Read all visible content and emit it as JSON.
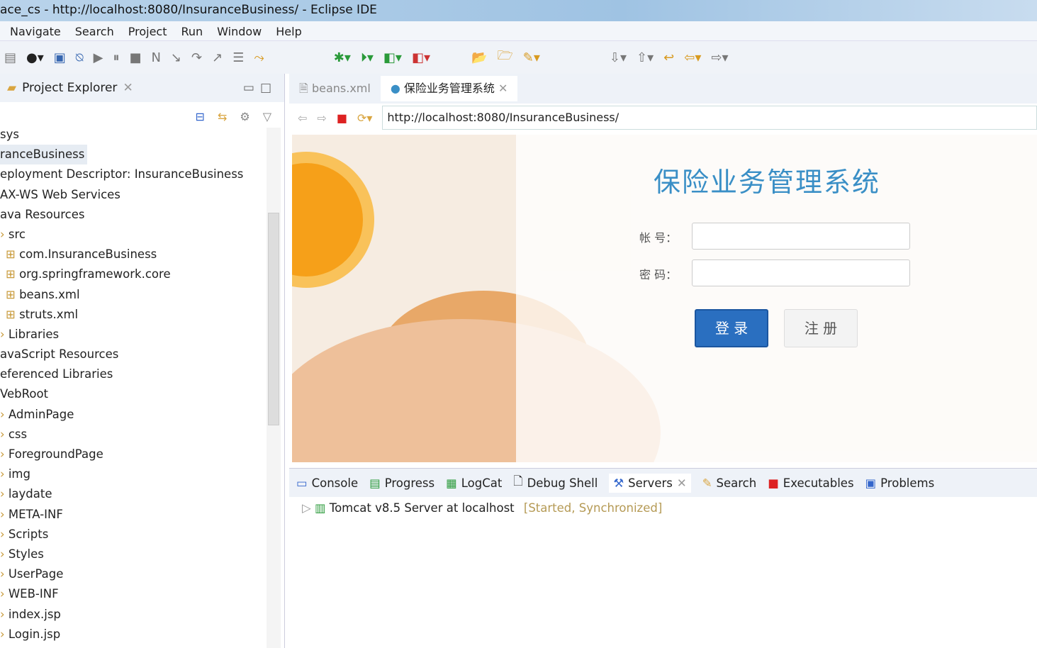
{
  "window": {
    "title": "ace_cs - http://localhost:8080/InsuranceBusiness/ - Eclipse IDE"
  },
  "menu": [
    "Navigate",
    "Search",
    "Project",
    "Run",
    "Window",
    "Help"
  ],
  "left_panel": {
    "tab": "Project Explorer",
    "tree": [
      {
        "label": "sys",
        "indent": 0
      },
      {
        "label": "ranceBusiness",
        "indent": 0,
        "selected": true
      },
      {
        "label": "eployment Descriptor: InsuranceBusiness",
        "indent": 0
      },
      {
        "label": "AX-WS Web Services",
        "indent": 0
      },
      {
        "label": "ava Resources",
        "indent": 0
      },
      {
        "label": "src",
        "indent": 1
      },
      {
        "label": "com.InsuranceBusiness",
        "indent": 2
      },
      {
        "label": "org.springframework.core",
        "indent": 2
      },
      {
        "label": "beans.xml",
        "indent": 2
      },
      {
        "label": "struts.xml",
        "indent": 2
      },
      {
        "label": "Libraries",
        "indent": 1
      },
      {
        "label": "avaScript Resources",
        "indent": 0
      },
      {
        "label": "eferenced Libraries",
        "indent": 0
      },
      {
        "label": "VebRoot",
        "indent": 0
      },
      {
        "label": "AdminPage",
        "indent": 1
      },
      {
        "label": "css",
        "indent": 1
      },
      {
        "label": "ForegroundPage",
        "indent": 1
      },
      {
        "label": "img",
        "indent": 1
      },
      {
        "label": "laydate",
        "indent": 1
      },
      {
        "label": "META-INF",
        "indent": 1
      },
      {
        "label": "Scripts",
        "indent": 1
      },
      {
        "label": "Styles",
        "indent": 1
      },
      {
        "label": "UserPage",
        "indent": 1
      },
      {
        "label": "WEB-INF",
        "indent": 1
      },
      {
        "label": "index.jsp",
        "indent": 1
      },
      {
        "label": "Login.jsp",
        "indent": 1
      }
    ]
  },
  "editor": {
    "tabs": [
      {
        "label": "beans.xml"
      },
      {
        "label": "保险业务管理系统",
        "active": true
      }
    ],
    "url": "http://localhost:8080/InsuranceBusiness/",
    "page": {
      "title": "保险业务管理系统",
      "account_label": "帐  号：",
      "password_label": "密  码：",
      "account_value": "",
      "password_value": "",
      "login": "登 录",
      "register": "注 册"
    }
  },
  "bottom": {
    "tabs": [
      "Console",
      "Progress",
      "LogCat",
      "Debug Shell",
      "Servers",
      "Search",
      "Executables",
      "Problems"
    ],
    "active": "Servers",
    "server": {
      "name": "Tomcat v8.5 Server at localhost",
      "status": "[Started, Synchronized]"
    }
  }
}
